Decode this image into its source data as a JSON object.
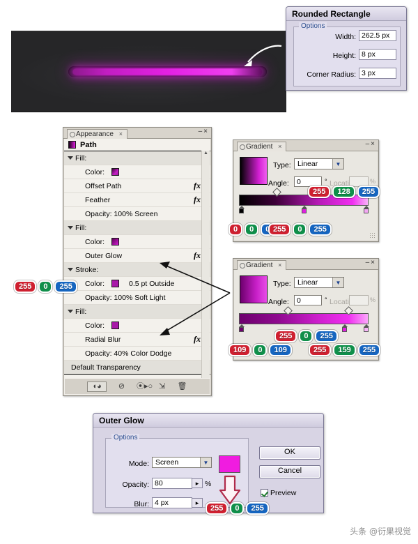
{
  "preview": {
    "description": "dark panel with magenta glowing horizontal bar",
    "bar_gradient_start": "#8d1a8d",
    "bar_gradient_mid": "#e321e3",
    "bar_gradient_end": "#5f0f5f",
    "background": "#272729"
  },
  "rounded_rectangle_dialog": {
    "title": "Rounded Rectangle",
    "group_label": "Options",
    "fields": [
      {
        "label": "Width:",
        "value": "262.5 px"
      },
      {
        "label": "Height:",
        "value": "8 px"
      },
      {
        "label": "Corner Radius:",
        "value": "3 px"
      }
    ]
  },
  "appearance_panel": {
    "tab_label": "Appearance",
    "tab_close": "×",
    "win_minimize": "–",
    "win_close": "×",
    "object_name": "Path",
    "rows": [
      {
        "type": "group",
        "label": "Fill:"
      },
      {
        "type": "item",
        "label": "Color:",
        "swatch": "gradient-magenta",
        "after": "",
        "fx": false
      },
      {
        "type": "item",
        "label": "Offset Path",
        "fx": true
      },
      {
        "type": "item",
        "label": "Feather",
        "fx": true
      },
      {
        "type": "item",
        "label": "Opacity: 100% Screen",
        "fx": false
      },
      {
        "type": "group",
        "label": "Fill:"
      },
      {
        "type": "item",
        "label": "Color:",
        "swatch": "gradient-purple",
        "fx": false
      },
      {
        "type": "item",
        "label": "Outer Glow",
        "fx": true
      },
      {
        "type": "group",
        "label": "Stroke:"
      },
      {
        "type": "item",
        "label": "Color:",
        "swatch": "solid-magenta",
        "after": "0.5 pt Outside",
        "fx": false
      },
      {
        "type": "item",
        "label": "Opacity: 100% Soft Light",
        "fx": false
      },
      {
        "type": "group",
        "label": "Fill:"
      },
      {
        "type": "item",
        "label": "Color:",
        "swatch": "solid-purple",
        "fx": false
      },
      {
        "type": "item",
        "label": "Radial Blur",
        "fx": true
      },
      {
        "type": "item",
        "label": "Opacity: 40% Color Dodge",
        "fx": false
      }
    ],
    "footer_label": "Default Transparency",
    "footer_icons": [
      "new-art-has-basic-appearance-icon",
      "clear-appearance-icon",
      "reduce-to-basic-appearance-icon",
      "duplicate-selected-item-icon",
      "delete-selected-item-icon"
    ]
  },
  "gradient_panel_1": {
    "tab_label": "Gradient",
    "tab_close": "×",
    "win_minimize": "–",
    "win_close": "×",
    "type_label": "Type:",
    "type_value": "Linear",
    "angle_label": "Angle:",
    "angle_value": "0",
    "angle_unit": "°",
    "location_label": "Location:",
    "location_value": "",
    "location_unit": "%",
    "stops": [
      {
        "position": 0,
        "rgb": [
          0,
          0,
          0
        ]
      },
      {
        "position": 52,
        "rgb": [
          255,
          0,
          255
        ]
      },
      {
        "position": 100,
        "rgb": [
          255,
          128,
          255
        ]
      }
    ]
  },
  "gradient_panel_2": {
    "tab_label": "Gradient",
    "tab_close": "×",
    "win_minimize": "–",
    "win_close": "×",
    "type_label": "Type:",
    "type_value": "Linear",
    "angle_label": "Angle:",
    "angle_value": "0",
    "angle_unit": "°",
    "location_label": "Location:",
    "location_value": "",
    "location_unit": "%",
    "stops": [
      {
        "position": 0,
        "rgb": [
          109,
          0,
          109
        ]
      },
      {
        "position": 85,
        "rgb": [
          255,
          0,
          255
        ]
      },
      {
        "position": 100,
        "rgb": [
          255,
          159,
          255
        ]
      }
    ]
  },
  "stroke_color_annotation": {
    "rgb": [
      255,
      0,
      255
    ]
  },
  "outer_glow_dialog": {
    "title": "Outer Glow",
    "group_label": "Options",
    "mode_label": "Mode:",
    "mode_value": "Screen",
    "glow_color": "#f01ce0",
    "opacity_label": "Opacity:",
    "opacity_value": "80",
    "opacity_unit": "%",
    "blur_label": "Blur:",
    "blur_value": "4 px",
    "ok_label": "OK",
    "cancel_label": "Cancel",
    "preview_label": "Preview",
    "preview_checked": true,
    "glow_color_annotation": {
      "rgb": [
        255,
        0,
        255
      ]
    }
  },
  "watermark": "头条 @衍果视觉"
}
